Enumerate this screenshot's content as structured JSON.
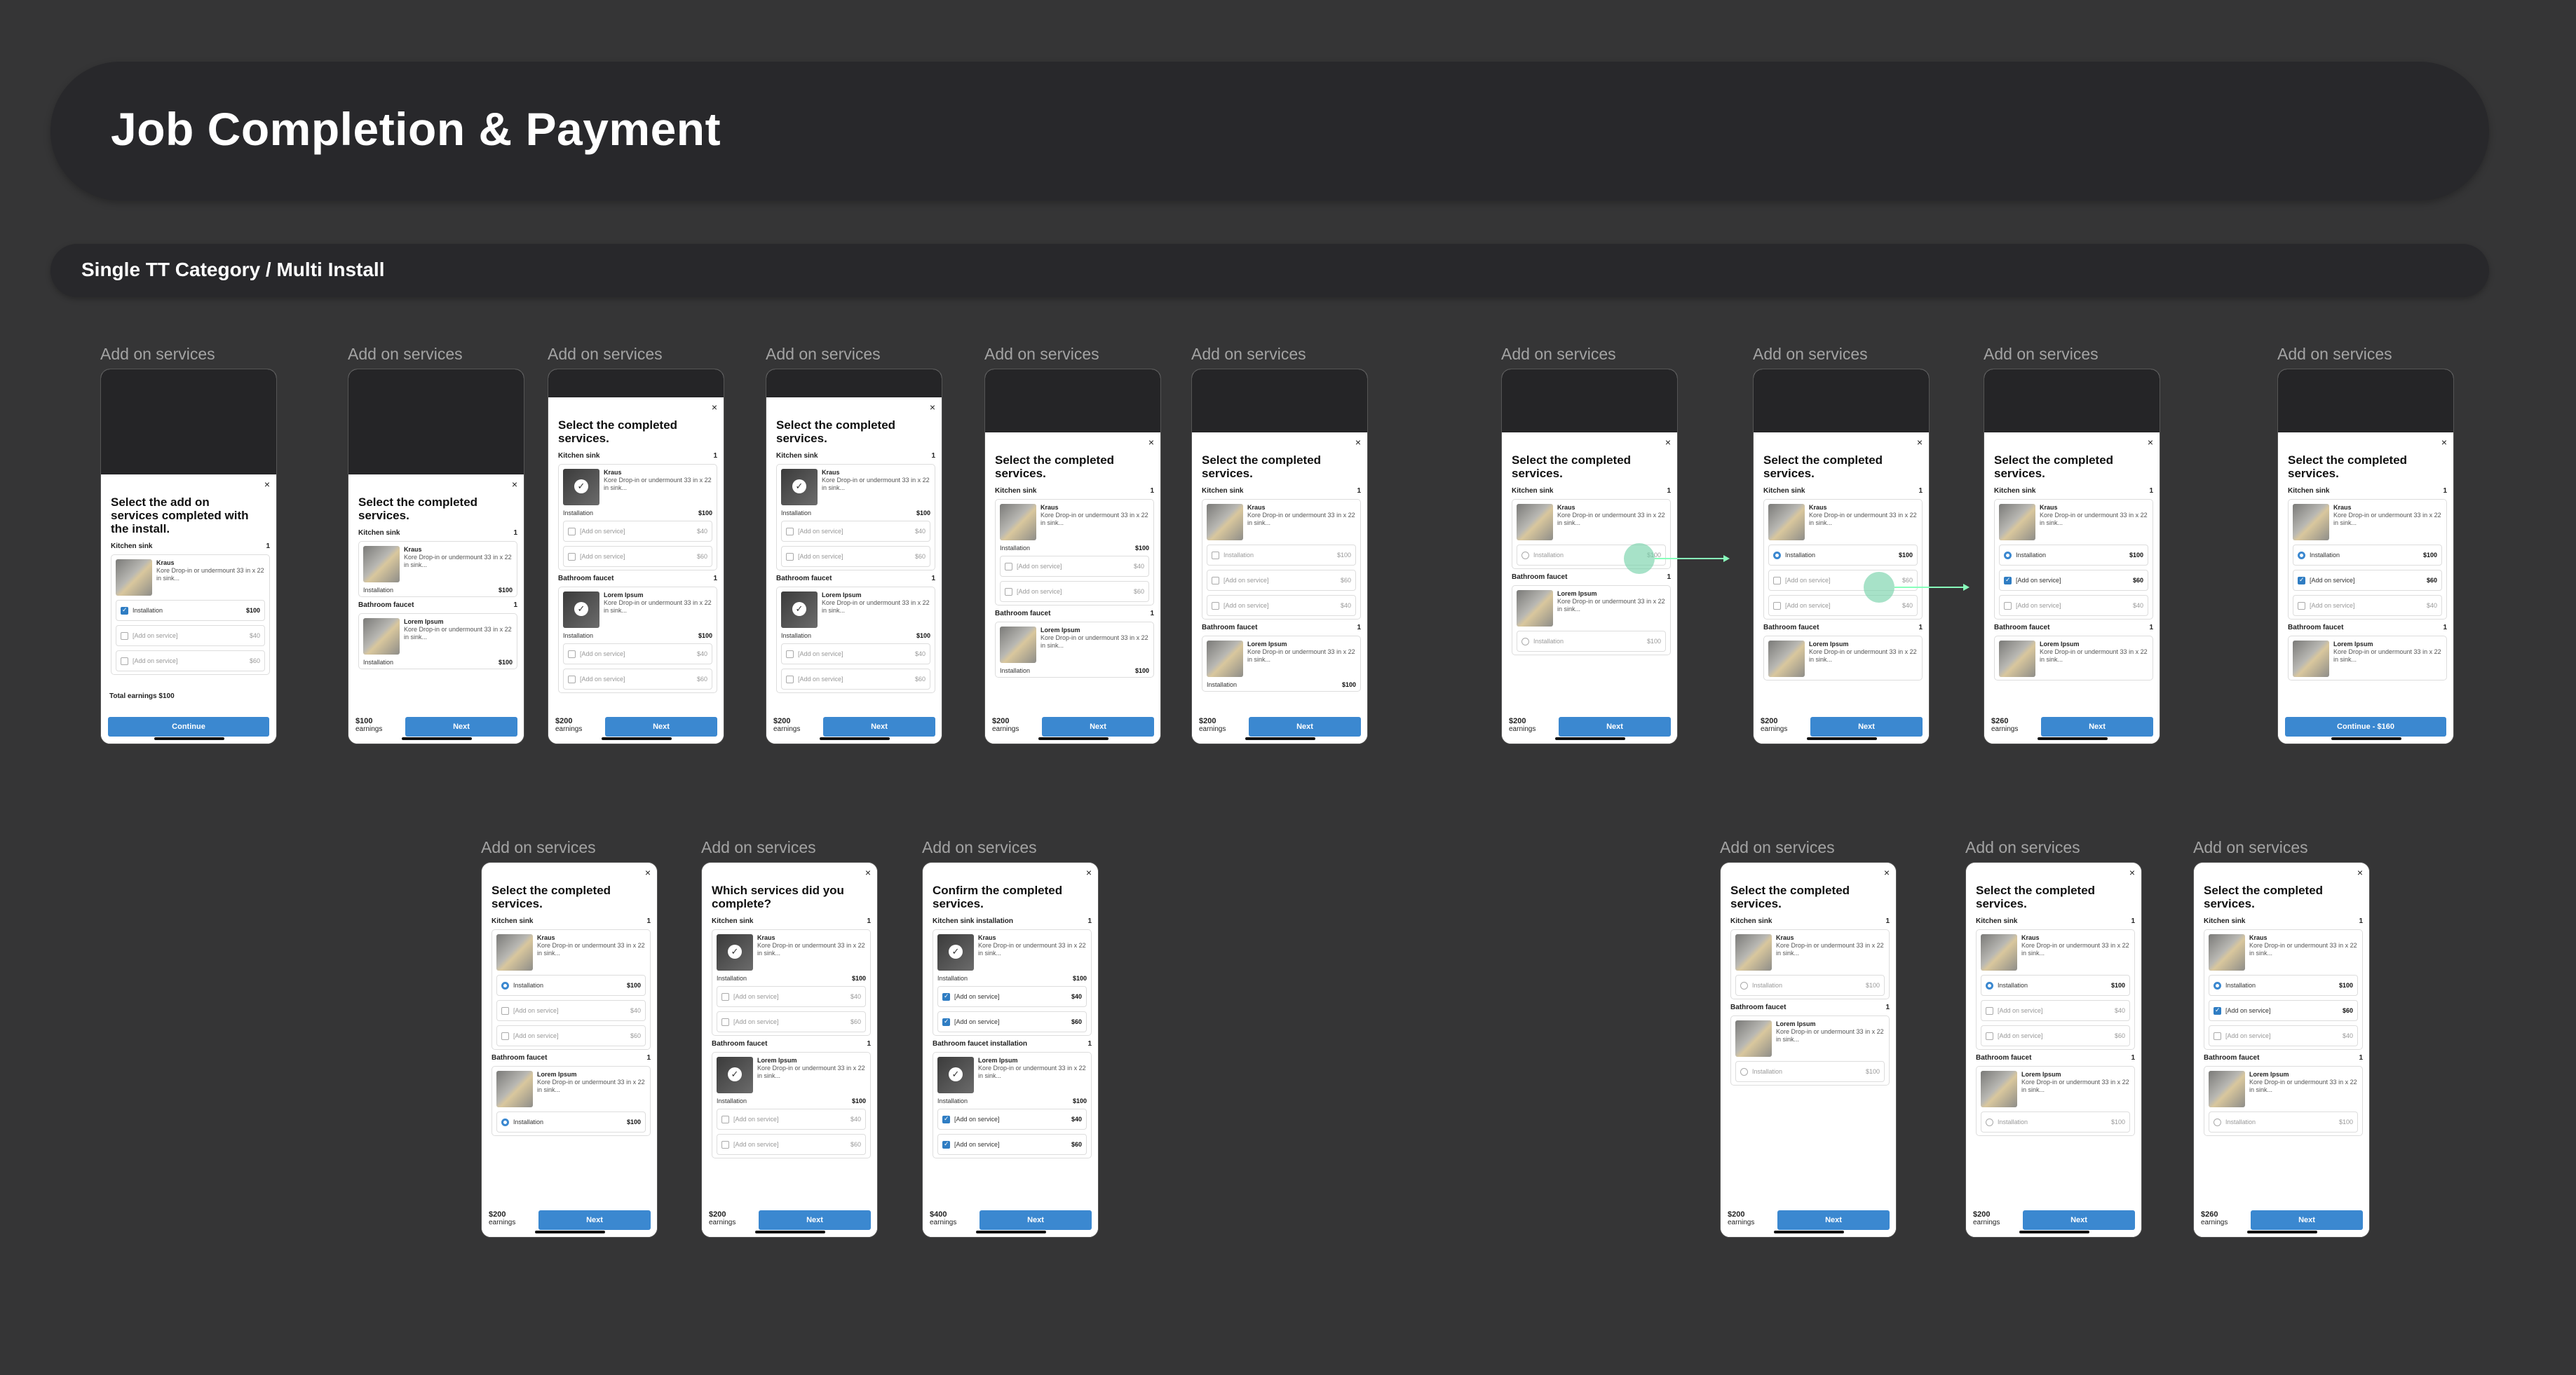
{
  "header": {
    "title": "Job Completion & Payment"
  },
  "subheader": {
    "title": "Single TT Category / Multi Install"
  },
  "frame_label": "Add on services",
  "close_glyph": "×",
  "titles": {
    "addon": "Select the add on services completed with the install.",
    "select": "Select the completed services.",
    "which": "Which services did you complete?",
    "confirm": "Confirm the completed services."
  },
  "sections": {
    "kitchen": "Kitchen sink",
    "bath": "Bathroom faucet",
    "kitchen_inst": "Kitchen sink installation",
    "bath_inst": "Bathroom faucet installation",
    "qty": "1"
  },
  "products": {
    "kraus": {
      "name": "Kraus",
      "desc": "Kore Drop-in or undermount 33 in x 22 in sink..."
    },
    "lorem": {
      "name": "Lorem Ipsum",
      "desc": "Kore Drop-in or undermount 33 in x 22 in sink..."
    }
  },
  "rows": {
    "installation": "Installation",
    "addon": "[Add on service]",
    "p100": "$100",
    "p40": "$40",
    "p60": "$60"
  },
  "footer": {
    "e100": "$100",
    "e200": "$200",
    "e260": "$260",
    "e400": "$400",
    "earnings": "earnings",
    "next": "Next",
    "continue": "Continue",
    "continue160": "Continue - $160",
    "total": "Total earnings $100"
  }
}
